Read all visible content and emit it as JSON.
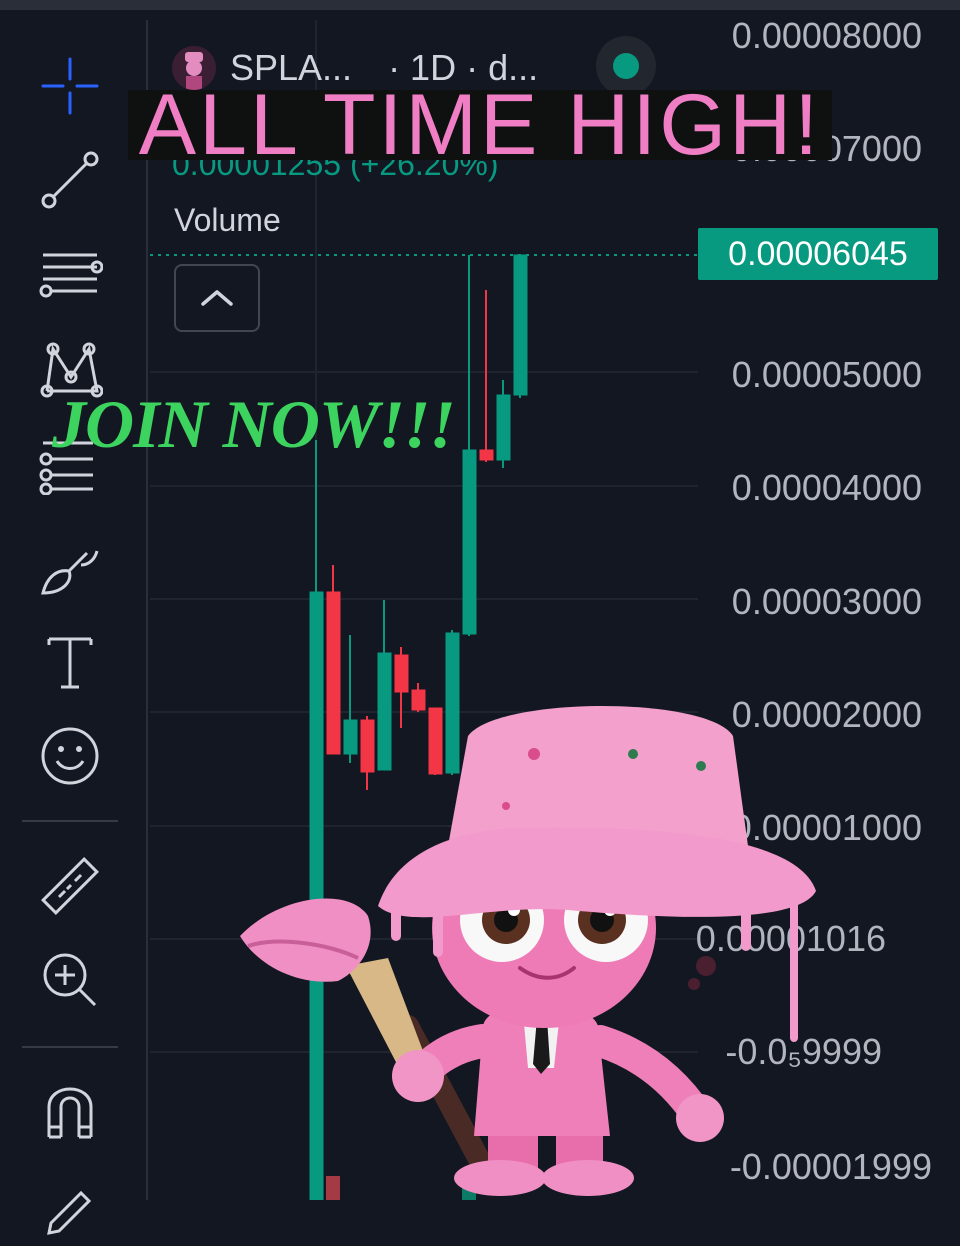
{
  "header": {
    "symbol": "SPLA...",
    "interval": "· 1D · d...",
    "change": "0.00001255 (+26.20%)",
    "volume_label": "Volume"
  },
  "banner": {
    "text": "ALL TIME HIGH!"
  },
  "promo": {
    "text": "JOIN NOW!!!"
  },
  "price_axis": {
    "labels": [
      "0.00008000",
      "0.00007000",
      "0.00005000",
      "0.00004000",
      "0.00003000",
      "0.00002000",
      "0.00001000",
      "0.00001016",
      "-0.0₅9999",
      "-0.00001999"
    ],
    "current_price": "0.00006045"
  },
  "colors": {
    "up": "#089981",
    "down": "#f23645",
    "background": "#131722",
    "banner_text": "#f07ec4",
    "promo_text": "#3dd35f"
  },
  "toolbar": {
    "tools": [
      "crosshair-icon",
      "trend-line-icon",
      "fib-retracement-icon",
      "xabcd-pattern-icon",
      "prediction-icon",
      "brush-icon",
      "text-icon",
      "emoji-icon",
      "ruler-icon",
      "zoom-in-icon",
      "magnet-icon",
      "pencil-icon"
    ]
  }
}
